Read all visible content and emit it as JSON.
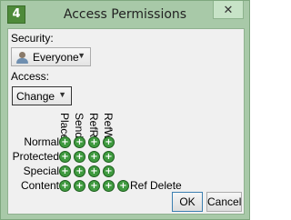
{
  "window": {
    "app_icon_text": "4",
    "title": "Access Permissions",
    "close_glyph": "✕"
  },
  "security": {
    "label": "Security:",
    "value": "Everyone",
    "icon": "user-icon"
  },
  "access": {
    "label": "Access:",
    "value": "Change"
  },
  "matrix": {
    "columns": [
      "Place",
      "Send",
      "RefR",
      "RefW"
    ],
    "rows": [
      "Normal",
      "Protected",
      "Special",
      "Content"
    ],
    "cell_glyph": "+",
    "extra_label": "Ref Delete"
  },
  "buttons": {
    "ok": "OK",
    "cancel": "Cancel"
  },
  "colors": {
    "frame": "#a8c9a8",
    "dot": "#3f9a3f"
  }
}
